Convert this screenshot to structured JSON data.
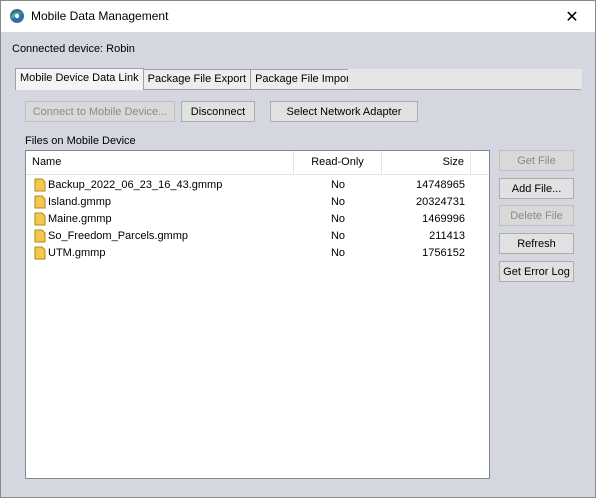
{
  "window": {
    "title": "Mobile Data Management",
    "close_glyph": "✕"
  },
  "connection": {
    "label": "Connected device: Robin"
  },
  "tabs": [
    {
      "label": "Mobile Device Data Link",
      "active": true
    },
    {
      "label": "Package File Export",
      "active": false
    },
    {
      "label": "Package File Import",
      "active": false
    }
  ],
  "toolbar": {
    "connect_label": "Connect to Mobile Device...",
    "disconnect_label": "Disconnect",
    "select_adapter_label": "Select Network Adapter"
  },
  "files": {
    "section_label": "Files on Mobile Device",
    "columns": {
      "name": "Name",
      "readonly": "Read-Only",
      "size": "Size"
    },
    "rows": [
      {
        "name": "Backup_2022_06_23_16_43.gmmp",
        "readonly": "No",
        "size": "14748965"
      },
      {
        "name": "Island.gmmp",
        "readonly": "No",
        "size": "20324731"
      },
      {
        "name": "Maine.gmmp",
        "readonly": "No",
        "size": "1469996"
      },
      {
        "name": "So_Freedom_Parcels.gmmp",
        "readonly": "No",
        "size": "211413"
      },
      {
        "name": "UTM.gmmp",
        "readonly": "No",
        "size": "1756152"
      }
    ]
  },
  "actions": {
    "get_file_label": "Get File",
    "add_file_label": "Add File...",
    "delete_file_label": "Delete File",
    "refresh_label": "Refresh",
    "get_error_log_label": "Get Error Log"
  },
  "colors": {
    "folder_fill": "#f2c94c",
    "folder_stroke": "#b8861b",
    "app_icon_green": "#3a8f3a"
  }
}
